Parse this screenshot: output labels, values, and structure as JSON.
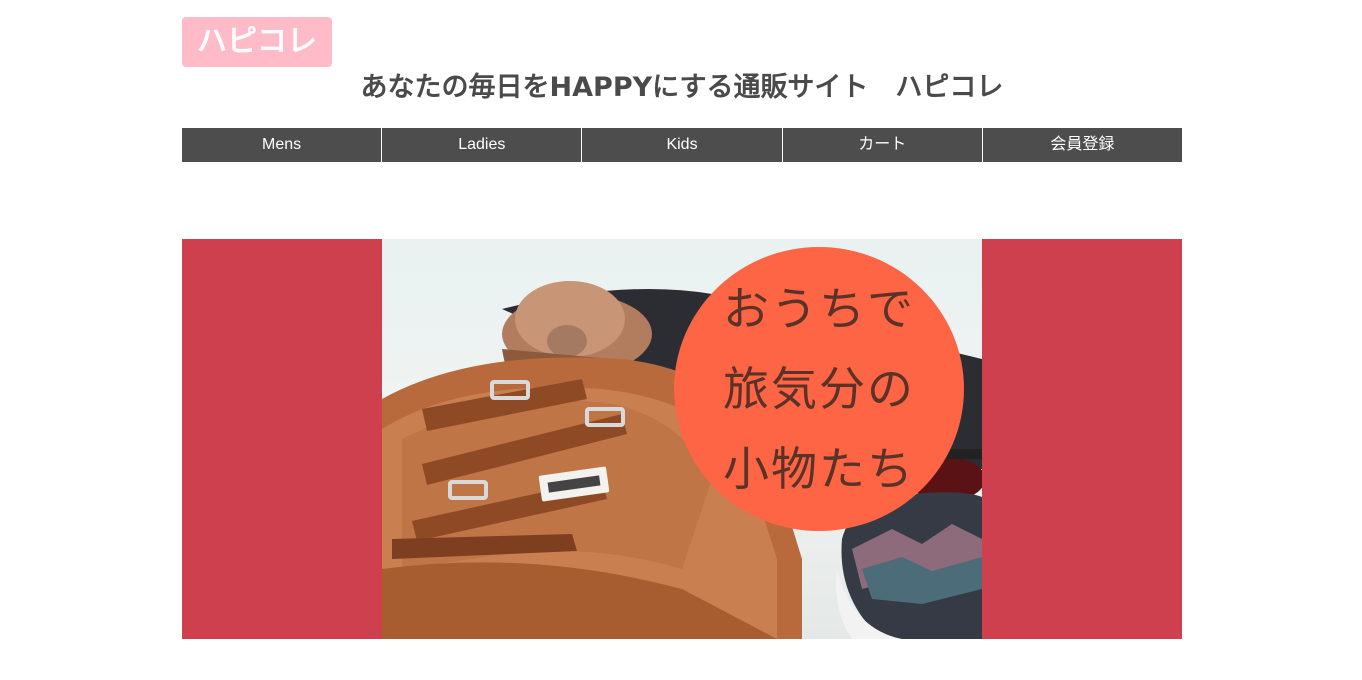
{
  "header": {
    "logo": "ハピコレ",
    "tagline": "あなたの毎日をHAPPYにする通販サイト　ハピコレ"
  },
  "nav": {
    "items": [
      {
        "label": "Mens"
      },
      {
        "label": "Ladies"
      },
      {
        "label": "Kids"
      },
      {
        "label": "カート"
      },
      {
        "label": "会員登録"
      }
    ]
  },
  "banner": {
    "lines": [
      "おうちで",
      "旅気分の",
      "小物たち"
    ],
    "colors": {
      "side": "#ce404d",
      "circle": "#fd6544",
      "circle_text": "#5a3228",
      "logo": "#ffbcc8",
      "nav": "#4d4d4d"
    },
    "image_subject": "brown backpack with hat, sunglasses and sneakers"
  }
}
